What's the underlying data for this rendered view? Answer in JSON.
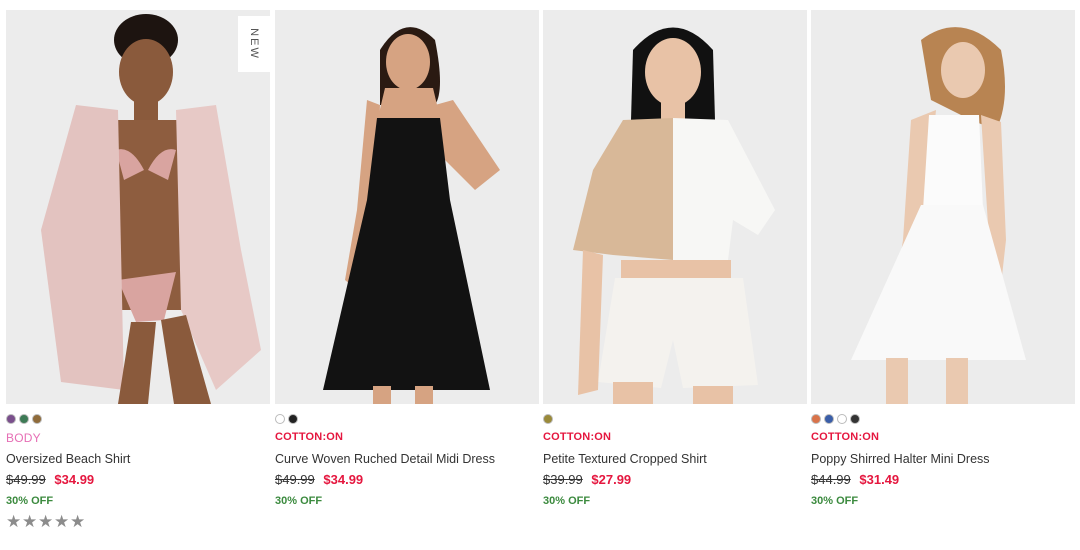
{
  "products": [
    {
      "badge": "NEW",
      "swatches": [
        "#7a4f8c",
        "#3d7a55",
        "#8f6b3a"
      ],
      "brand": "BODY",
      "name": "Oversized Beach Shirt",
      "was_price": "$49.99",
      "now_price": "$34.99",
      "discount": "30% OFF",
      "rating_stars": 0
    },
    {
      "swatches": [
        "#ffffff",
        "#222222"
      ],
      "brand": "COTTON:ON",
      "name": "Curve Woven Ruched Detail Midi Dress",
      "was_price": "$49.99",
      "now_price": "$34.99",
      "discount": "30% OFF"
    },
    {
      "swatches": [
        "#9a8a3a"
      ],
      "brand": "COTTON:ON",
      "name": "Petite Textured Cropped Shirt",
      "was_price": "$39.99",
      "now_price": "$27.99",
      "discount": "30% OFF"
    },
    {
      "swatches": [
        "#d9734a",
        "#3a5ea8",
        "#ffffff",
        "#333333"
      ],
      "brand": "COTTON:ON",
      "name": "Poppy Shirred Halter Mini Dress",
      "was_price": "$44.99",
      "now_price": "$31.49",
      "discount": "30% OFF"
    }
  ],
  "colors": {
    "brand_red": "#e5173f",
    "body_pink": "#e66fb5",
    "discount_green": "#3b8a3e",
    "star_grey": "#8c8c8c"
  }
}
